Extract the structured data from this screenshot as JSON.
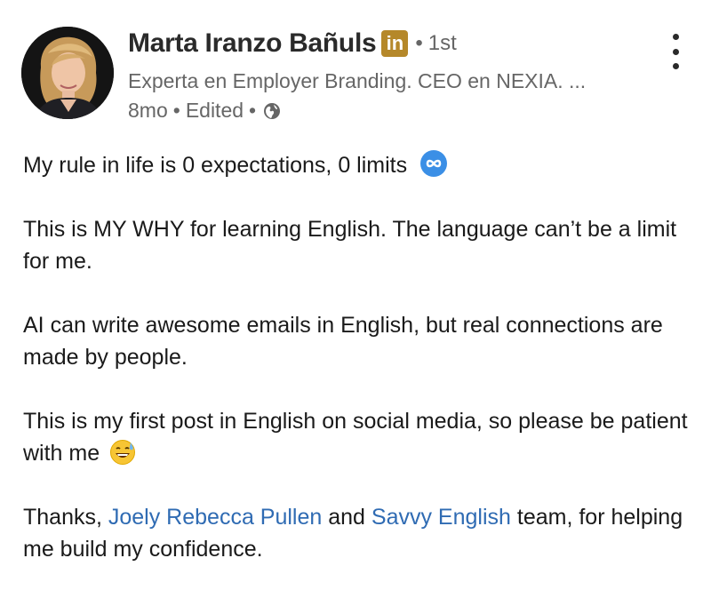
{
  "post": {
    "author": {
      "name": "Marta Iranzo Bañuls",
      "badge_text": "in",
      "degree": "1st",
      "headline": "Experta en Employer Branding. CEO en NEXIA. ...",
      "time": "8mo",
      "edited": "Edited",
      "visibility_icon": "globe-icon"
    },
    "body": {
      "p1": "My rule in life is 0 expectations, 0 limits",
      "p1_icon": "infinity-icon",
      "p2": "This is MY WHY for learning English. The language can’t be a limit for me.",
      "p3": "AI can write awesome emails in English, but real connections are made by people.",
      "p4": "This is my first post in English on social media, so please be patient with me",
      "p4_icon": "sweat-smile-emoji",
      "p5_prefix": "Thanks, ",
      "mention_1": "Joely Rebecca Pullen",
      "p5_middle": " and ",
      "mention_2": "Savvy English",
      "p5_suffix": " team, for helping me build my confidence."
    },
    "colors": {
      "link": "#2f6bb3",
      "badge": "#b5882a",
      "secondary_text": "#666666"
    }
  }
}
